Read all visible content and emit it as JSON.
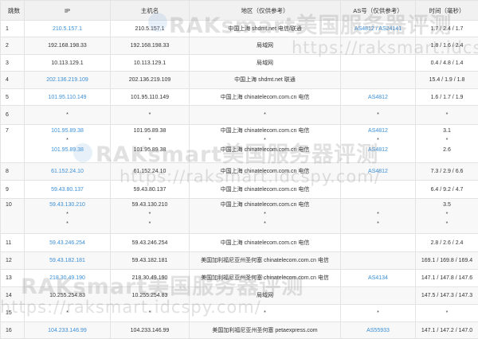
{
  "headers": {
    "hop": "跳数",
    "ip": "IP",
    "host": "主机名",
    "region": "地区（仅供参考）",
    "as": "AS号（仅供参考）",
    "time": "时间（毫秒）"
  },
  "rows": [
    {
      "hop": "1",
      "lines": [
        {
          "ip": "210.5.157.1",
          "host": "210.5.157.1",
          "region": "中国上海 shdmt.net 电信/联通",
          "as": [
            "AS4812",
            "AS24141"
          ],
          "time": "1.7 / 2.4 / 1.7"
        }
      ]
    },
    {
      "hop": "2",
      "lines": [
        {
          "ip": "192.168.198.33",
          "host": "192.168.198.33",
          "region": "局域网",
          "as": [],
          "time": "1.8 / 1.6 / 2.4"
        }
      ]
    },
    {
      "hop": "3",
      "lines": [
        {
          "ip": "10.113.129.1",
          "host": "10.113.129.1",
          "region": "局域网",
          "as": [],
          "time": "0.4 / 4.8 / 1.4"
        }
      ]
    },
    {
      "hop": "4",
      "lines": [
        {
          "ip": "202.136.219.109",
          "host": "202.136.219.109",
          "region": "中国上海 shdmt.net 联通",
          "as": [],
          "time": "15.4 / 1.9 / 1.8"
        }
      ]
    },
    {
      "hop": "5",
      "lines": [
        {
          "ip": "101.95.110.149",
          "host": "101.95.110.149",
          "region": "中国上海 chinatelecom.com.cn 电信",
          "as": [
            "AS4812"
          ],
          "time": "1.6 / 1.7 / 1.9"
        }
      ]
    },
    {
      "hop": "6",
      "lines": [
        {
          "ip": "*",
          "host": "*",
          "region": "*",
          "as": [
            "*"
          ],
          "time": "*"
        }
      ]
    },
    {
      "hop": "7",
      "lines": [
        {
          "ip": "101.95.89.38",
          "host": "101.95.89.38",
          "region": "中国上海 chinatelecom.com.cn 电信",
          "as": [
            "AS4812"
          ],
          "time": "3.1"
        },
        {
          "ip": "*",
          "host": "*",
          "region": "*",
          "as": [
            "*"
          ],
          "time": "*"
        },
        {
          "ip": "101.95.89.38",
          "host": "101.95.89.38",
          "region": "中国上海 chinatelecom.com.cn 电信",
          "as": [
            "AS4812"
          ],
          "time": "2.6"
        }
      ]
    },
    {
      "hop": "8",
      "lines": [
        {
          "ip": "61.152.24.10",
          "host": "61.152.24.10",
          "region": "中国上海 chinatelecom.com.cn 电信",
          "as": [
            "AS4812"
          ],
          "time": "7.3 / 2.9 / 6.6"
        }
      ]
    },
    {
      "hop": "9",
      "lines": [
        {
          "ip": "59.43.80.137",
          "host": "59.43.80.137",
          "region": "中国上海 chinatelecom.com.cn 电信",
          "as": [],
          "time": "6.4 / 9.2 / 4.7"
        }
      ]
    },
    {
      "hop": "10",
      "lines": [
        {
          "ip": "59.43.130.210",
          "host": "59.43.130.210",
          "region": "中国上海 chinatelecom.com.cn 电信",
          "as": [],
          "time": "3.5"
        },
        {
          "ip": "*",
          "host": "*",
          "region": "*",
          "as": [
            "*"
          ],
          "time": "*"
        },
        {
          "ip": "*",
          "host": "*",
          "region": "*",
          "as": [
            "*"
          ],
          "time": "*"
        }
      ]
    },
    {
      "hop": "11",
      "lines": [
        {
          "ip": "59.43.246.254",
          "host": "59.43.246.254",
          "region": "中国上海 chinatelecom.com.cn 电信",
          "as": [],
          "time": "2.8 / 2.6 / 2.4"
        }
      ]
    },
    {
      "hop": "12",
      "lines": [
        {
          "ip": "59.43.182.181",
          "host": "59.43.182.181",
          "region": "美国加利福尼亚州圣何塞 chinatelecom.com.cn 电信",
          "as": [],
          "time": "169.1 / 169.8 / 169.4"
        }
      ]
    },
    {
      "hop": "13",
      "lines": [
        {
          "ip": "218.30.49.190",
          "host": "218.30.49.190",
          "region": "美国加利福尼亚州圣何塞 chinatelecom.com.cn 电信",
          "as": [
            "AS4134"
          ],
          "time": "147.1 / 147.8 / 147.6"
        }
      ]
    },
    {
      "hop": "14",
      "lines": [
        {
          "ip": "10.255.254.83",
          "host": "10.255.254.83",
          "region": "局域网",
          "as": [],
          "time": "147.5 / 147.3 / 147.3"
        }
      ]
    },
    {
      "hop": "15",
      "lines": [
        {
          "ip": "*",
          "host": "*",
          "region": "*",
          "as": [
            "*"
          ],
          "time": "*"
        }
      ]
    },
    {
      "hop": "16",
      "lines": [
        {
          "ip": "104.233.146.99",
          "host": "104.233.146.99",
          "region": "美国加利福尼亚州圣何塞 petaexpress.com",
          "as": [
            "AS55933"
          ],
          "time": "147.1 / 147.2 / 147.0"
        }
      ]
    }
  ],
  "watermarks": [
    {
      "name": "RAKsmart美国服务器评测",
      "url": "https://raksmart.idcspy.com/"
    },
    {
      "name": "RAKsmart美国服务器评测",
      "url": "https://raksmart.idcspy.com/"
    },
    {
      "name": "RAKsmart美国服务器评测",
      "url": "https://raksmart.idcspy.com/"
    }
  ]
}
